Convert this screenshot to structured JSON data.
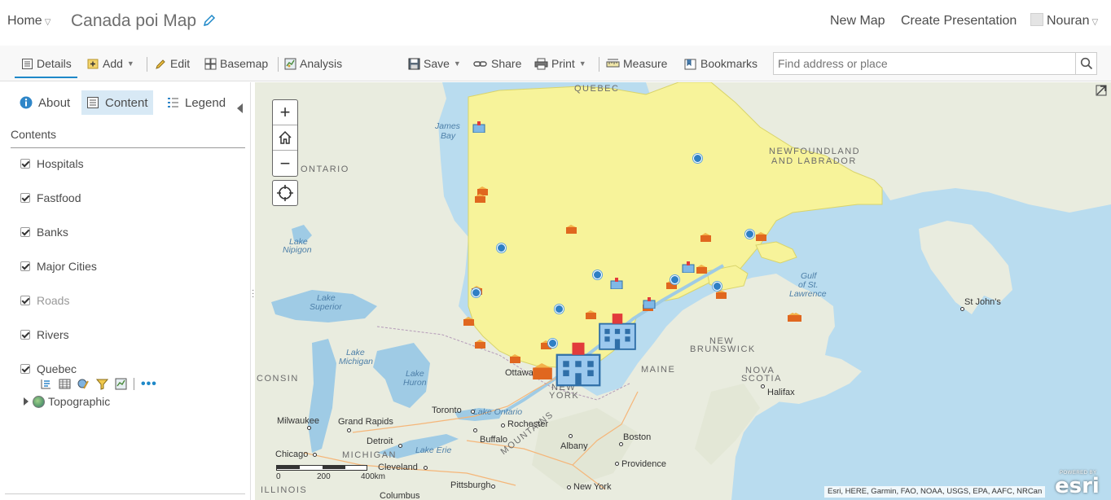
{
  "header": {
    "home_label": "Home",
    "map_title": "Canada poi Map",
    "new_map": "New Map",
    "create_presentation": "Create Presentation",
    "user_name": "Nouran"
  },
  "toolbar": {
    "details": "Details",
    "add": "Add",
    "edit": "Edit",
    "basemap": "Basemap",
    "analysis": "Analysis",
    "save": "Save",
    "share": "Share",
    "print": "Print",
    "measure": "Measure",
    "bookmarks": "Bookmarks",
    "search_placeholder": "Find address or place"
  },
  "panel": {
    "tabs": {
      "about": "About",
      "content": "Content",
      "legend": "Legend"
    },
    "active_tab": "Content",
    "contents_heading": "Contents",
    "layers": [
      {
        "name": "Hospitals",
        "checked": true,
        "dimmed": false
      },
      {
        "name": "Fastfood",
        "checked": true,
        "dimmed": false
      },
      {
        "name": "Banks",
        "checked": true,
        "dimmed": false
      },
      {
        "name": "Major Cities",
        "checked": true,
        "dimmed": false
      },
      {
        "name": "Roads",
        "checked": true,
        "dimmed": true
      },
      {
        "name": "Rivers",
        "checked": true,
        "dimmed": false
      },
      {
        "name": "Quebec",
        "checked": true,
        "dimmed": false
      }
    ],
    "basemap_layer": "Topographic",
    "layer_tool_icons": [
      "show-legend-icon",
      "show-table-icon",
      "change-style-icon",
      "filter-icon",
      "perform-analysis-icon",
      "more-options-icon"
    ]
  },
  "map": {
    "controls": {
      "zoom_in": "+",
      "zoom_out": "−"
    },
    "regions": [
      "QUEBEC",
      "ONTARIO",
      "NEWFOUNDLAND",
      "AND LABRADOR",
      "NEW",
      "BRUNSWICK",
      "MAINE",
      "NOVA",
      "SCOTIA",
      "NEW",
      "YORK",
      "MICHIGAN",
      "ILLINOIS",
      "CONSIN",
      "MOUNTAINS"
    ],
    "water": [
      "James",
      "Bay",
      "Lake",
      "Nipigon",
      "Lake",
      "Superior",
      "Lake",
      "Michigan",
      "Lake",
      "Huron",
      "Lake Ontario",
      "Lake Erie",
      "Gulf",
      "of St.",
      "Lawrence"
    ],
    "cities": [
      "Ottawa",
      "Toronto",
      "Rochester",
      "Buffalo",
      "Detroit",
      "Grand Rapids",
      "Milwaukee",
      "Chicago",
      "Cleveland",
      "Albany",
      "Boston",
      "Providence",
      "Pittsburgh",
      "New York",
      "Halifax",
      "St John's",
      "Columbus"
    ],
    "scale": {
      "labels": [
        "0",
        "200",
        "400km"
      ]
    },
    "attribution": "Esri, HERE, Garmin, FAO, NOAA, USGS, EPA, AAFC, NRCan",
    "esri_powered": "POWERED BY",
    "esri_logo": "esri",
    "colors": {
      "water": "#b9dcef",
      "land": "#e9ecdf",
      "quebec_fill": "#f7f39a",
      "accent": "#1e88c8"
    }
  }
}
